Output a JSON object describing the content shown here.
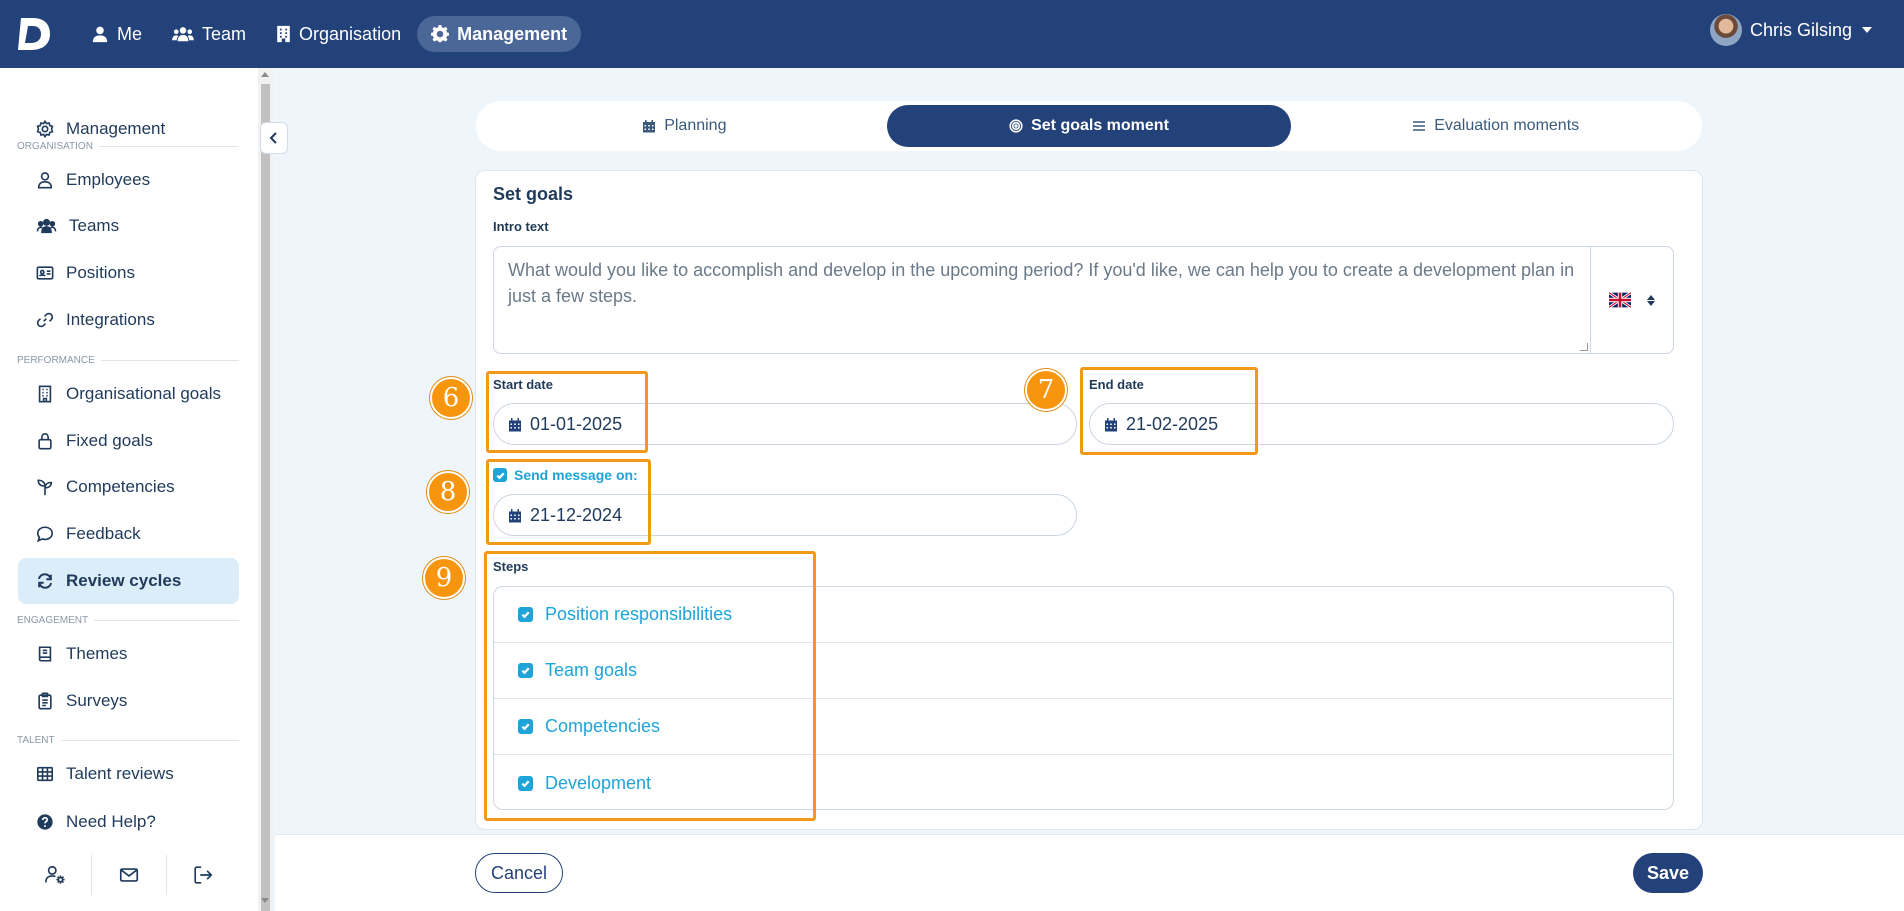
{
  "nav": {
    "items": [
      {
        "label": "Me",
        "icon": "user-icon"
      },
      {
        "label": "Team",
        "icon": "users-icon"
      },
      {
        "label": "Organisation",
        "icon": "building-icon"
      },
      {
        "label": "Management",
        "icon": "gear-icon",
        "active": true
      }
    ],
    "user_name": "Chris Gilsing"
  },
  "sidebar": {
    "top_item": "Management",
    "sections": {
      "organisation": "ORGANISATION",
      "performance": "PERFORMANCE",
      "engagement": "ENGAGEMENT",
      "talent": "TALENT"
    },
    "items": {
      "employees": "Employees",
      "teams": "Teams",
      "positions": "Positions",
      "integrations": "Integrations",
      "organisational_goals": "Organisational goals",
      "fixed_goals": "Fixed goals",
      "competencies": "Competencies",
      "feedback": "Feedback",
      "review_cycles": "Review cycles",
      "themes": "Themes",
      "surveys": "Surveys",
      "talent_reviews": "Talent reviews",
      "need_help": "Need Help?"
    }
  },
  "tabs": [
    {
      "label": "Planning",
      "icon": "calendar-icon"
    },
    {
      "label": "Set goals moment",
      "icon": "target-icon",
      "active": true
    },
    {
      "label": "Evaluation moments",
      "icon": "list-icon"
    }
  ],
  "form": {
    "title": "Set goals",
    "intro_label": "Intro text",
    "intro_value": "What would you like to accomplish and develop in the upcoming period? If you'd like, we can help you to create a development plan in just a few steps.",
    "language": "English (UK)",
    "start_date_label": "Start date",
    "start_date": "01-01-2025",
    "end_date_label": "End date",
    "end_date": "21-02-2025",
    "send_message_label": "Send message on:",
    "send_message_checked": true,
    "send_message_date": "21-12-2024",
    "steps_label": "Steps",
    "steps": [
      {
        "label": "Position responsibilities",
        "checked": true
      },
      {
        "label": "Team goals",
        "checked": true
      },
      {
        "label": "Competencies",
        "checked": true
      },
      {
        "label": "Development",
        "checked": true
      }
    ]
  },
  "annotations": {
    "badge_6": "6",
    "badge_7": "7",
    "badge_8": "8",
    "badge_9": "9"
  },
  "footer": {
    "cancel_label": "Cancel",
    "save_label": "Save"
  },
  "colors": {
    "brand": "#23427a",
    "accent": "#1ea4d9",
    "highlight": "#f29a17"
  }
}
